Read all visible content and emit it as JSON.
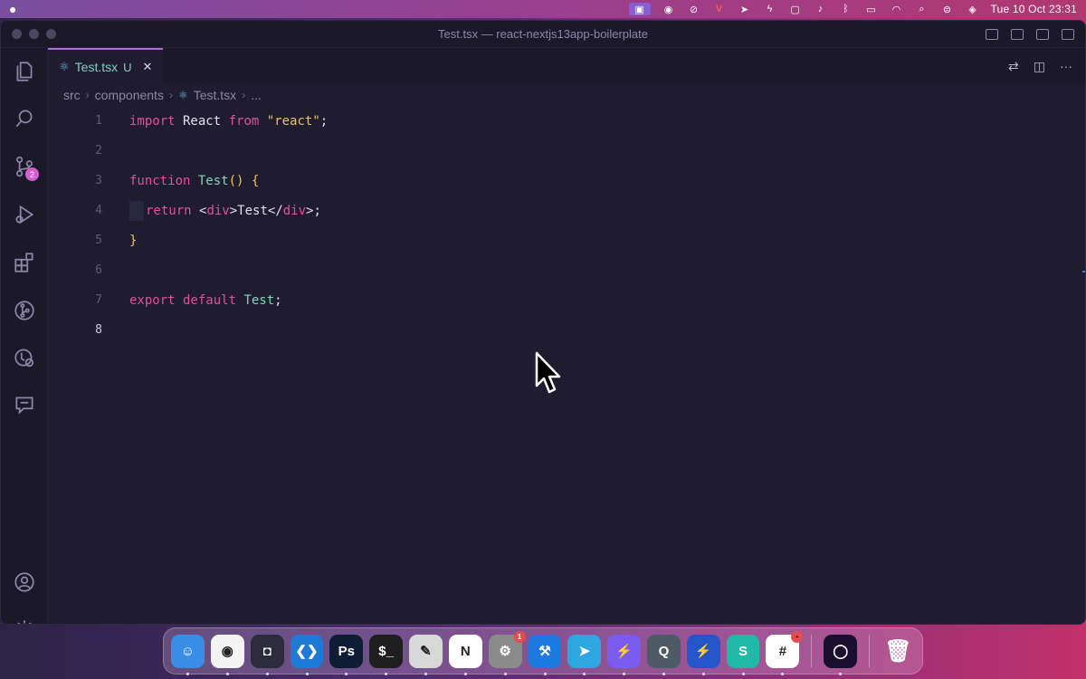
{
  "menubar": {
    "apple": "",
    "clock": "Tue 10 Oct  23:31",
    "status_icons": [
      "screen-mirroring-icon",
      "record-icon",
      "bell-slash-icon",
      "vivaldi-icon",
      "telegram-icon",
      "bolt-icon",
      "stop-icon",
      "volume-icon",
      "bluetooth-icon",
      "battery-icon",
      "wifi-icon",
      "search-icon",
      "control-center-icon",
      "siri-icon"
    ]
  },
  "window": {
    "title": "Test.tsx — react-nextjs13app-boilerplate"
  },
  "activity_bar": {
    "items": [
      "explorer-icon",
      "search-icon",
      "source-control-icon",
      "run-debug-icon",
      "extensions-icon",
      "git-graph-icon",
      "remote-explorer-icon",
      "comments-icon"
    ],
    "source_control_badge": "2",
    "bottom": [
      "account-icon",
      "settings-gear-icon"
    ]
  },
  "tab": {
    "filename": "Test.tsx",
    "status": "U",
    "close": "✕"
  },
  "breadcrumb": {
    "parts": [
      "src",
      "components",
      "Test.tsx",
      "..."
    ]
  },
  "editor": {
    "line_numbers": [
      "1",
      "2",
      "3",
      "4",
      "5",
      "6",
      "7",
      "8"
    ],
    "current_line": "8",
    "lines": {
      "l1": {
        "kw1": "import",
        "id": " React ",
        "kw2": "from",
        "str": " \"react\"",
        "end": ";"
      },
      "l3": {
        "kw": "function",
        "fn": " Test",
        "paren": "()",
        "brace": " {"
      },
      "l4": {
        "kw": "return",
        "lt": " <",
        "tag1": "div",
        "gt": ">",
        "text": "Test",
        "lt2": "</",
        "tag2": "div",
        "end": ">;"
      },
      "l5": {
        "brace": "}"
      },
      "l7": {
        "kw1": "export",
        "kw2": " default",
        "fn": " Test",
        "end": ";"
      }
    }
  },
  "dock": {
    "apps": [
      {
        "name": "Finder",
        "icon": "finder-icon",
        "color": "#3b8ee8",
        "glyph": "☺"
      },
      {
        "name": "Chrome",
        "icon": "chrome-icon",
        "color": "#f4f4f4",
        "glyph": "◉"
      },
      {
        "name": "Screen Recorder",
        "icon": "screen-recorder-icon",
        "color": "#2b2b3b",
        "glyph": "◘"
      },
      {
        "name": "VS Code",
        "icon": "vscode-icon",
        "color": "#1f7ad6",
        "glyph": "❮❯"
      },
      {
        "name": "Photoshop",
        "icon": "photoshop-icon",
        "color": "#0e1c36",
        "glyph": "Ps"
      },
      {
        "name": "Terminal",
        "icon": "terminal-icon",
        "color": "#1e1e1e",
        "glyph": "$_"
      },
      {
        "name": "Pixelmator",
        "icon": "pixelmator-icon",
        "color": "#d8d8d8",
        "glyph": "✎"
      },
      {
        "name": "Notion",
        "icon": "notion-icon",
        "color": "#ffffff",
        "glyph": "N"
      },
      {
        "name": "System Settings",
        "icon": "system-settings-icon",
        "color": "#8a8a8a",
        "glyph": "⚙",
        "badge": "1"
      },
      {
        "name": "Xcode",
        "icon": "xcode-icon",
        "color": "#1d7ae0",
        "glyph": "⚒"
      },
      {
        "name": "Telegram",
        "icon": "telegram-icon",
        "color": "#2ea6e0",
        "glyph": "➤"
      },
      {
        "name": "Messenger",
        "icon": "messenger-icon",
        "color": "#7b5cf0",
        "glyph": "⚡"
      },
      {
        "name": "QuickTime",
        "icon": "quicktime-icon",
        "color": "#4e5a66",
        "glyph": "Q"
      },
      {
        "name": "Reeder",
        "icon": "bolt-app-icon",
        "color": "#2556c9",
        "glyph": "⚡"
      },
      {
        "name": "Surfshark",
        "icon": "surfshark-icon",
        "color": "#1fb9a6",
        "glyph": "S"
      },
      {
        "name": "Slack",
        "icon": "slack-icon",
        "color": "#ffffff",
        "glyph": "#",
        "badge": "•"
      }
    ],
    "after_separator": [
      {
        "name": "Arc",
        "icon": "arc-browser-icon",
        "color": "#1a0f2e",
        "glyph": "◯"
      }
    ],
    "trash": {
      "name": "Trash",
      "icon": "trash-icon",
      "color": "transparent",
      "glyph": "🗑"
    }
  }
}
